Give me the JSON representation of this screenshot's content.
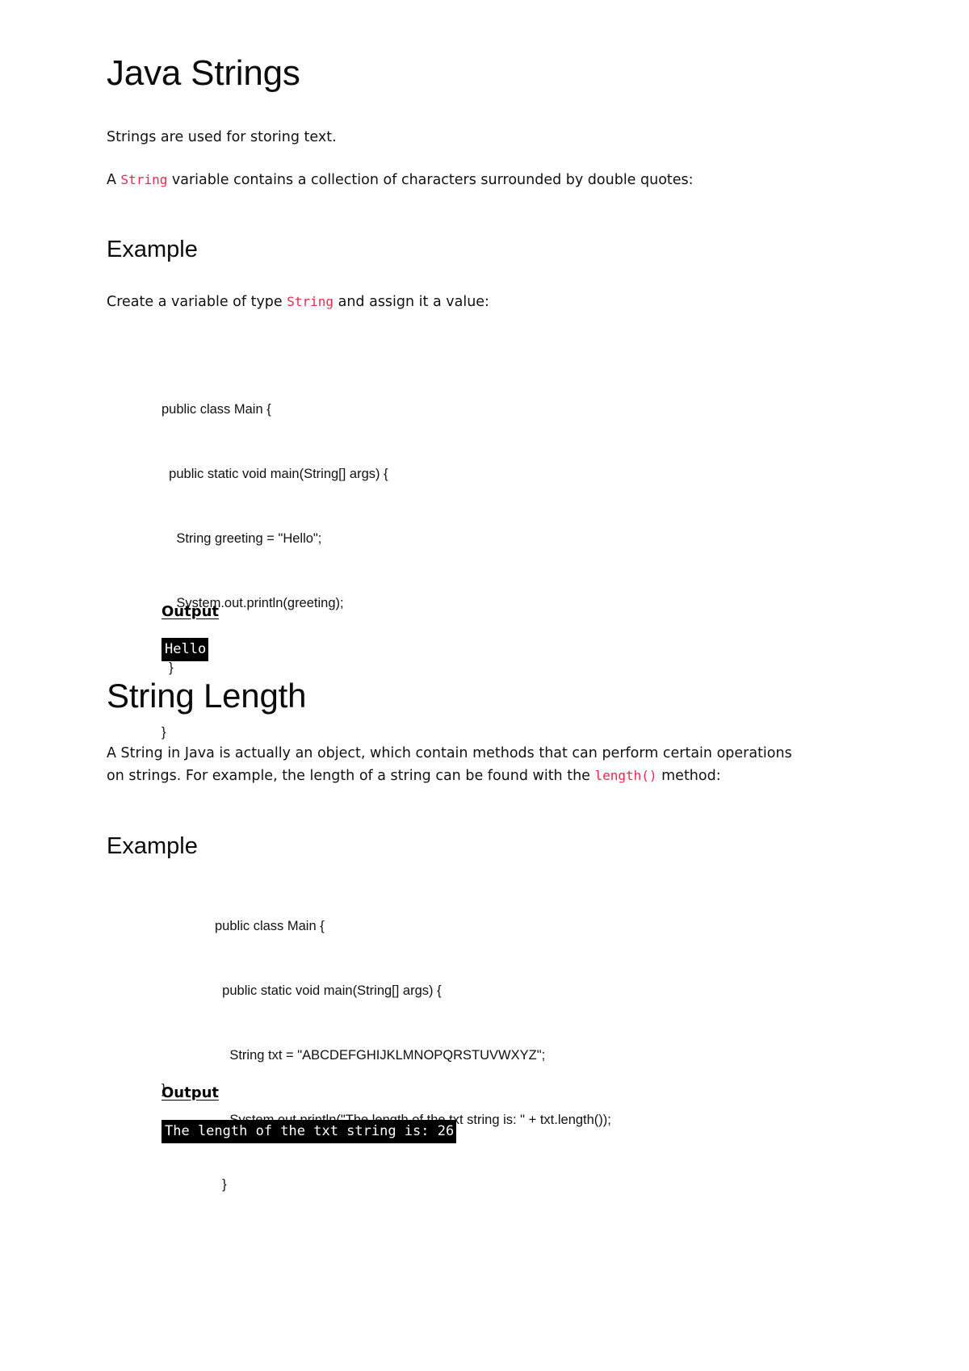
{
  "document": {
    "title": "Java Strings",
    "intro_paragraph": "Strings are used for storing text.",
    "definition": {
      "before": "A ",
      "code": "String",
      "after": " variable contains a collection of characters surrounded by double quotes:"
    }
  },
  "section_example_1": {
    "heading": "Example",
    "description": {
      "before": "Create a variable of type ",
      "code": "String",
      "after": " and assign it a value:"
    },
    "code_lines": [
      "public class Main {",
      "  public static void main(String[] args) {",
      "    String greeting = \"Hello\";",
      "    System.out.println(greeting);",
      "  }",
      "}"
    ],
    "output_label": "Output",
    "output_text": "Hello"
  },
  "section_string_length": {
    "heading": "String Length",
    "paragraph": {
      "line1": "A String in Java is actually an object, which contain methods that can",
      "line2": "perform certain operations on strings. For example, the length of a string can",
      "line3_before": "be found with the ",
      "line3_code": "length()",
      "line3_after": " method:"
    },
    "example_heading": "Example",
    "code_lines": [
      "public class Main {",
      "  public static void main(String[] args) {",
      "    String txt = \"ABCDEFGHIJKLMNOPQRSTUVWXYZ\";",
      "    System.out.println(\"The length of the txt string is: \" + txt.length());",
      "  }",
      "}"
    ],
    "output_label": "Output",
    "output_text": "The length of the txt string is: 26"
  },
  "colors": {
    "inline_code": "#e8294b",
    "output_background": "#000000",
    "output_foreground": "#ffffff",
    "body_text": "#111111",
    "page_background": "#ffffff"
  }
}
